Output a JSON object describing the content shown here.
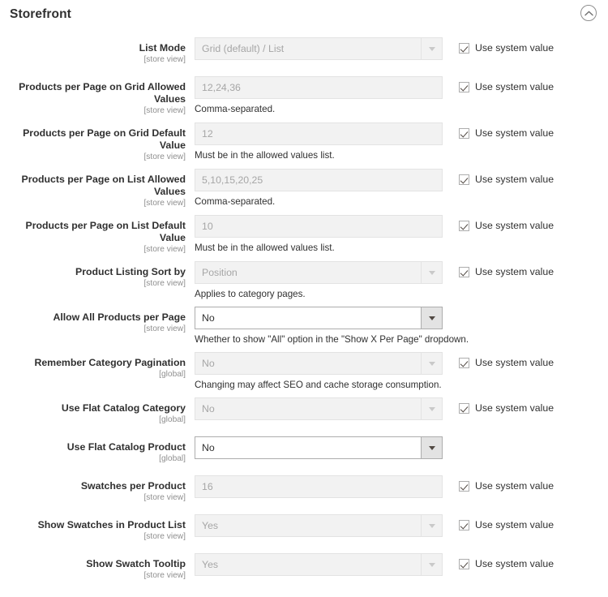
{
  "header": {
    "title": "Storefront",
    "collapse_icon": "chevron-up-circle-icon"
  },
  "common": {
    "use_system_value_label": "Use system value",
    "dropdown_arrow_icon": "chevron-down-icon"
  },
  "fields": [
    {
      "label": "List Mode",
      "scope": "[store view]",
      "type": "select",
      "value": "Grid (default) / List",
      "disabled": true,
      "note": "",
      "use_system_value": true
    },
    {
      "label": "Products per Page on Grid Allowed Values",
      "scope": "[store view]",
      "type": "text",
      "value": "12,24,36",
      "disabled": true,
      "note": "Comma-separated.",
      "use_system_value": true
    },
    {
      "label": "Products per Page on Grid Default Value",
      "scope": "[store view]",
      "type": "text",
      "value": "12",
      "disabled": true,
      "note": "Must be in the allowed values list.",
      "use_system_value": true
    },
    {
      "label": "Products per Page on List Allowed Values",
      "scope": "[store view]",
      "type": "text",
      "value": "5,10,15,20,25",
      "disabled": true,
      "note": "Comma-separated.",
      "use_system_value": true
    },
    {
      "label": "Products per Page on List Default Value",
      "scope": "[store view]",
      "type": "text",
      "value": "10",
      "disabled": true,
      "note": "Must be in the allowed values list.",
      "use_system_value": true
    },
    {
      "label": "Product Listing Sort by",
      "scope": "[store view]",
      "type": "select",
      "value": "Position",
      "disabled": true,
      "note": "Applies to category pages.",
      "use_system_value": true
    },
    {
      "label": "Allow All Products per Page",
      "scope": "[store view]",
      "type": "select",
      "value": "No",
      "disabled": false,
      "note": "Whether to show \"All\" option in the \"Show X Per Page\" dropdown.",
      "use_system_value": false
    },
    {
      "label": "Remember Category Pagination",
      "scope": "[global]",
      "type": "select",
      "value": "No",
      "disabled": true,
      "note": "Changing may affect SEO and cache storage consumption.",
      "use_system_value": true
    },
    {
      "label": "Use Flat Catalog Category",
      "scope": "[global]",
      "type": "select",
      "value": "No",
      "disabled": true,
      "note": "",
      "use_system_value": true
    },
    {
      "label": "Use Flat Catalog Product",
      "scope": "[global]",
      "type": "select",
      "value": "No",
      "disabled": false,
      "note": "",
      "use_system_value": false
    },
    {
      "label": "Swatches per Product",
      "scope": "[store view]",
      "type": "text",
      "value": "16",
      "disabled": true,
      "note": "",
      "use_system_value": true
    },
    {
      "label": "Show Swatches in Product List",
      "scope": "[store view]",
      "type": "select",
      "value": "Yes",
      "disabled": true,
      "note": "",
      "use_system_value": true
    },
    {
      "label": "Show Swatch Tooltip",
      "scope": "[store view]",
      "type": "select",
      "value": "Yes",
      "disabled": true,
      "note": "",
      "use_system_value": true
    }
  ],
  "colors": {
    "text": "#303030",
    "muted": "#a6a6a6",
    "scope": "#8f8f8f",
    "disabled_bg": "#f2f2f2",
    "disabled_border": "#e3e3e3",
    "enabled_border": "#adadad",
    "arrow_button_bg": "#e3e3e3"
  }
}
